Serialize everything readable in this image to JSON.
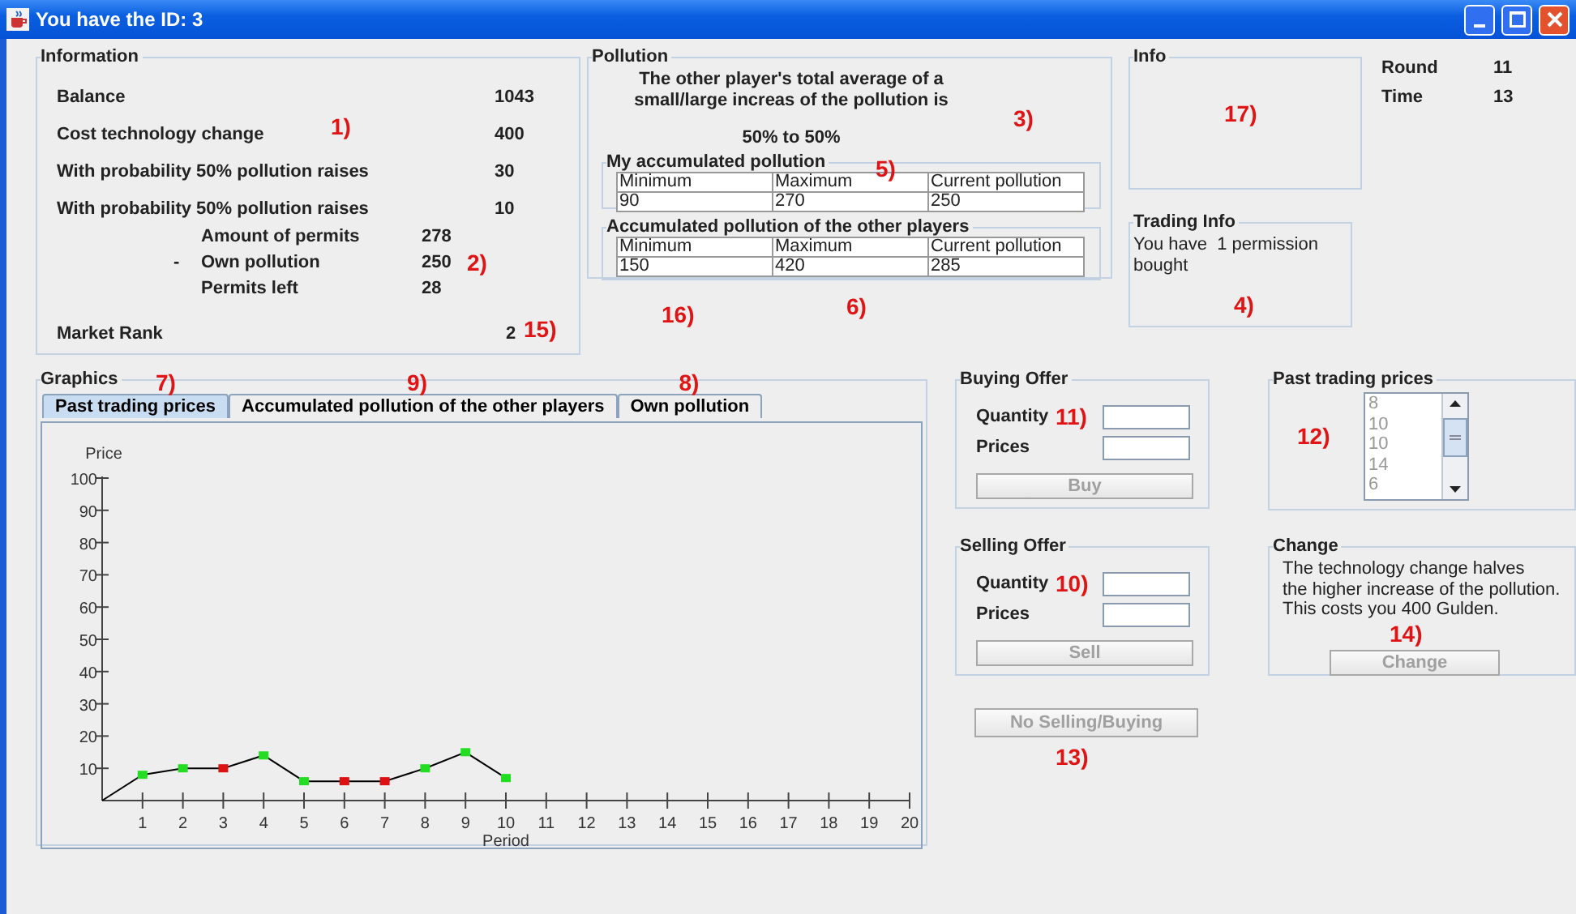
{
  "window": {
    "title": "You have the ID: 3"
  },
  "information": {
    "title": "Information",
    "annotation": "1)",
    "rows": [
      {
        "label": "Balance",
        "value": "1043"
      },
      {
        "label": "Cost technology change",
        "value": "400"
      },
      {
        "label": "With probability 50% pollution raises",
        "value": "30"
      },
      {
        "label": "With probability 50% pollution raises",
        "value": "10"
      }
    ],
    "permits": [
      {
        "label": "Amount of permits",
        "value": "278"
      },
      {
        "prefix": "-",
        "label": "Own pollution",
        "value": "250",
        "annotation": "2)"
      },
      {
        "label": "Permits left",
        "value": "28"
      }
    ],
    "rank": {
      "label": "Market Rank",
      "value": "2",
      "annotation": "15)"
    }
  },
  "pollution": {
    "title": "Pollution",
    "lines": [
      "The other player's total average of a",
      "small/large increas of the pollution is"
    ],
    "annotation": "3)",
    "ratio": "50% to 50%",
    "below_annotation": "16)",
    "tables": [
      {
        "title": "My accumulated pollution",
        "annotation": "5)",
        "columns": [
          "Minimum",
          "Maximum",
          "Current pollution"
        ],
        "row": [
          "90",
          "270",
          "250"
        ]
      },
      {
        "title": "Accumulated pollution of the other players",
        "annotation": "6)",
        "columns": [
          "Minimum",
          "Maximum",
          "Current pollution"
        ],
        "row": [
          "150",
          "420",
          "285"
        ]
      }
    ]
  },
  "info": {
    "title": "Info",
    "annotation": "17)"
  },
  "trading_info": {
    "title": "Trading Info",
    "text": "You have  1 permission bought",
    "annotation": "4)"
  },
  "status": [
    {
      "label": "Round",
      "value": "11"
    },
    {
      "label": "Time",
      "value": "13"
    }
  ],
  "graphics": {
    "title": "Graphics",
    "tabs": [
      {
        "label": "Past trading prices",
        "selected": true,
        "annotation": "7)"
      },
      {
        "label": "Accumulated pollution of the other players",
        "selected": false,
        "annotation": "9)"
      },
      {
        "label": "Own pollution",
        "selected": false,
        "annotation": "8)"
      }
    ],
    "chart_data": {
      "type": "line",
      "xlabel": "Period",
      "ylabel": "Price",
      "x": [
        0,
        1,
        2,
        3,
        4,
        5,
        6,
        7,
        8,
        9,
        10
      ],
      "series": [
        {
          "color": "#000000",
          "marker": "square",
          "values": [
            0,
            8,
            10,
            10,
            14,
            6,
            6,
            6,
            10,
            15,
            7
          ]
        }
      ],
      "xlim": [
        0,
        20
      ],
      "ylim": [
        0,
        100
      ],
      "xticks": [
        1,
        2,
        3,
        4,
        5,
        6,
        7,
        8,
        9,
        10,
        11,
        12,
        13,
        14,
        15,
        16,
        17,
        18,
        19,
        20
      ],
      "yticks": [
        10,
        20,
        30,
        40,
        50,
        60,
        70,
        80,
        90,
        100
      ]
    },
    "points": [
      {
        "kind": "origin"
      },
      {
        "color": "#22dd22"
      },
      {
        "color": "#22dd22"
      },
      {
        "color": "#dd1111"
      },
      {
        "color": "#22dd22"
      },
      {
        "color": "#22dd22"
      },
      {
        "color": "#dd1111"
      },
      {
        "color": "#dd1111"
      },
      {
        "color": "#22dd22"
      },
      {
        "color": "#22dd22"
      },
      {
        "color": "#22dd22"
      }
    ]
  },
  "buying_offer": {
    "title": "Buying Offer",
    "fields": [
      {
        "label": "Quantity",
        "annotation": "11)"
      },
      {
        "label": "Prices"
      }
    ],
    "button": {
      "label": "Buy",
      "disabled": true
    }
  },
  "selling_offer": {
    "title": "Selling Offer",
    "fields": [
      {
        "label": "Quantity",
        "annotation": "10)"
      },
      {
        "label": "Prices"
      }
    ],
    "button": {
      "label": "Sell",
      "disabled": true
    }
  },
  "no_trade_button": {
    "label": "No Selling/Buying",
    "disabled": true,
    "annotation": "13)"
  },
  "past_prices": {
    "title": "Past trading prices",
    "annotation": "12)",
    "items": [
      "8",
      "10",
      "10",
      "14",
      "6"
    ]
  },
  "change": {
    "title": "Change",
    "lines": [
      "The technology change halves",
      "the higher increase of the pollution.",
      "This costs you 400 Gulden."
    ],
    "annotation": "14)",
    "button": {
      "label": "Change",
      "disabled": true
    }
  }
}
